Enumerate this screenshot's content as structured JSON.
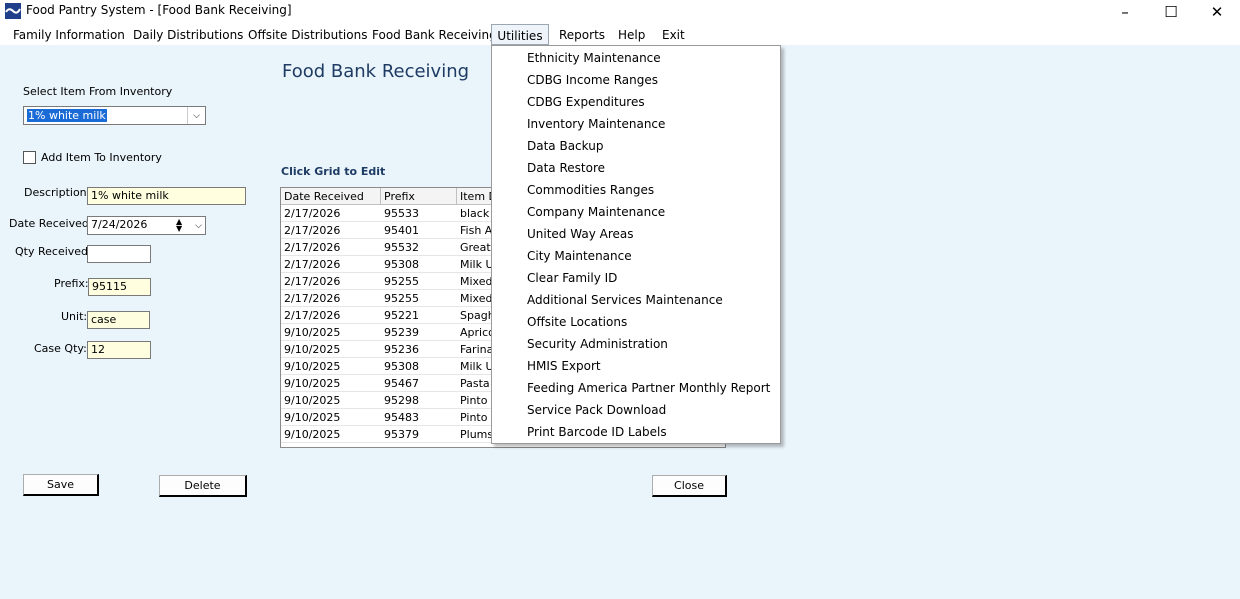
{
  "window": {
    "title": "Food Pantry System - [Food Bank Receiving]",
    "minimize_glyph": "–",
    "maximize_glyph": "☐",
    "close_glyph": "✕"
  },
  "menubar": [
    "Family Information",
    "Daily Distributions",
    "Offsite Distributions",
    "Food Bank Receiving",
    "Utilities",
    "Reports",
    "Help",
    "Exit"
  ],
  "utilities_menu": [
    "Ethnicity Maintenance",
    "CDBG Income Ranges",
    "CDBG Expenditures",
    "Inventory Maintenance",
    "Data Backup",
    "Data Restore",
    "Commodities Ranges",
    "Company Maintenance",
    "United Way Areas",
    "City Maintenance",
    "Clear Family ID",
    "Additional Services Maintenance",
    "Offsite Locations",
    "Security Administration",
    "HMIS Export",
    "Feeding America Partner Monthly Report",
    "Service Pack Download",
    "Print Barcode ID Labels"
  ],
  "form": {
    "heading": "Food Bank Receiving",
    "select_label": "Select Item From Inventory",
    "select_value": "1% white milk",
    "add_item_label": "Add Item To Inventory",
    "add_item_checked": false,
    "description_label": "Description:",
    "description_value": "1% white milk",
    "date_label": "Date Received:",
    "date_value": "7/24/2026",
    "qty_label": "Qty Received:",
    "qty_value": "",
    "prefix_label": "Prefix:",
    "prefix_value": "95115",
    "unit_label": "Unit:",
    "unit_value": "case",
    "caseqty_label": "Case Qty:",
    "caseqty_value": "12",
    "grid_caption": "Click Grid to Edit"
  },
  "grid": {
    "columns": [
      "Date Received",
      "Prefix",
      "Item D"
    ],
    "rows": [
      [
        "2/17/2026",
        "95533",
        "black b"
      ],
      [
        "2/17/2026",
        "95401",
        "Fish A"
      ],
      [
        "2/17/2026",
        "95532",
        "Great N"
      ],
      [
        "2/17/2026",
        "95308",
        "Milk U"
      ],
      [
        "2/17/2026",
        "95255",
        "Mixed"
      ],
      [
        "2/17/2026",
        "95255",
        "Mixed"
      ],
      [
        "2/17/2026",
        "95221",
        "Spaghe"
      ],
      [
        "9/10/2025",
        "95239",
        "Aprico"
      ],
      [
        "9/10/2025",
        "95236",
        "Farina"
      ],
      [
        "9/10/2025",
        "95308",
        "Milk U"
      ],
      [
        "9/10/2025",
        "95467",
        "Pasta"
      ],
      [
        "9/10/2025",
        "95298",
        "Pinto B"
      ],
      [
        "9/10/2025",
        "95483",
        "Pinto B"
      ],
      [
        "9/10/2025",
        "95379",
        "Plums"
      ]
    ]
  },
  "buttons": {
    "save": "Save",
    "delete": "Delete",
    "close": "Close"
  }
}
